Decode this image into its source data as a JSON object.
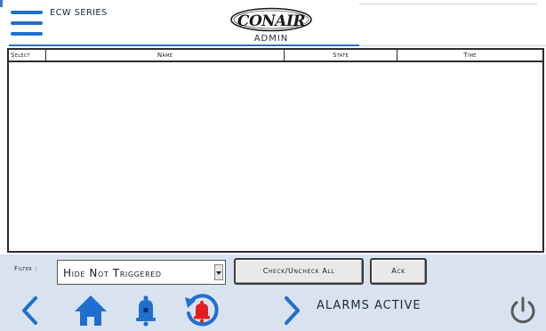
{
  "header": {
    "series_label": "ECW SERIES",
    "logo_text": "CONAIR",
    "role": "ADMIN"
  },
  "table": {
    "columns": [
      "Select",
      "Name",
      "State",
      "Time"
    ],
    "rows": []
  },
  "filter": {
    "label": "Filter :",
    "selected": "Hide Not Triggered"
  },
  "buttons": {
    "check_uncheck": "Check/Uncheck All",
    "ack": "Ack"
  },
  "footer": {
    "status": "ALARMS ACTIVE",
    "icons": [
      "chevron-left-icon",
      "home-icon",
      "bell-icon",
      "alarm-history-icon",
      "chevron-right-icon",
      "power-icon"
    ]
  },
  "colors": {
    "accent_blue": "#1f6fd1",
    "panel_bg": "#d9e3ef",
    "alarm_red": "#e02020"
  }
}
